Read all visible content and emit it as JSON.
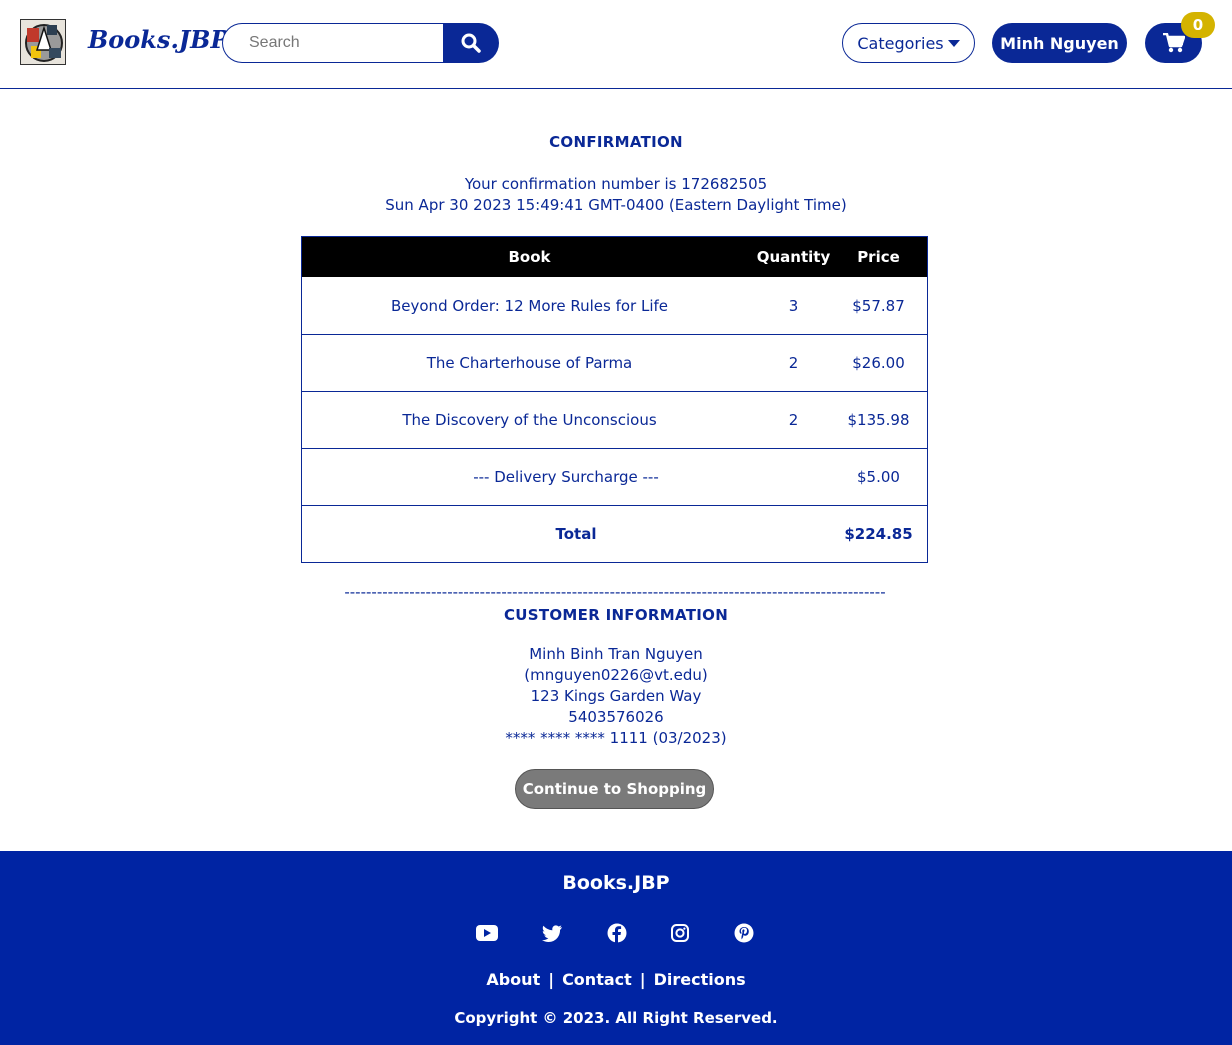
{
  "header": {
    "brand": "Books.JBP",
    "search_placeholder": "Search",
    "categories_label": "Categories",
    "user_label": "Minh Nguyen",
    "cart_count": "0",
    "icons": {
      "search": "search-icon",
      "caret": "caret-down-icon",
      "cart": "shopping-cart-icon"
    }
  },
  "confirmation": {
    "heading": "CONFIRMATION",
    "number_line": "Your confirmation number is 172682505",
    "date_line": "Sun Apr 30 2023 15:49:41 GMT-0400 (Eastern Daylight Time)"
  },
  "order_table": {
    "headers": {
      "book": "Book",
      "quantity": "Quantity",
      "price": "Price"
    },
    "rows": [
      {
        "book": "Beyond Order: 12 More Rules for Life",
        "quantity": "3",
        "price": "$57.87"
      },
      {
        "book": "The Charterhouse of Parma",
        "quantity": "2",
        "price": "$26.00"
      },
      {
        "book": "The Discovery of the Unconscious",
        "quantity": "2",
        "price": "$135.98"
      }
    ],
    "surcharge": {
      "label": "--- Delivery Surcharge ---",
      "price": "$5.00"
    },
    "total": {
      "label": "Total",
      "price": "$224.85"
    }
  },
  "divider": "----------------------------------------------------------------------------------------------------",
  "customer": {
    "heading": "CUSTOMER INFORMATION",
    "name": "Minh Binh Tran Nguyen",
    "email": "(mnguyen0226@vt.edu)",
    "address": "123 Kings Garden Way",
    "phone": "5403576026",
    "card": "**** **** **** 1111 (03/2023)"
  },
  "continue_label": "Continue to Shopping",
  "footer": {
    "brand": "Books.JBP",
    "social_icons": [
      "youtube-icon",
      "twitter-icon",
      "facebook-icon",
      "instagram-icon",
      "pinterest-icon"
    ],
    "links": {
      "about": "About",
      "contact": "Contact",
      "directions": "Directions",
      "separator": "|"
    },
    "copyright": "Copyright © 2023. All Right Reserved."
  },
  "colors": {
    "primary": "#0a2896",
    "footer_bg": "#0024a3",
    "badge": "#d4b300",
    "table_head": "#000000",
    "button_gray": "#7a7a7a"
  }
}
